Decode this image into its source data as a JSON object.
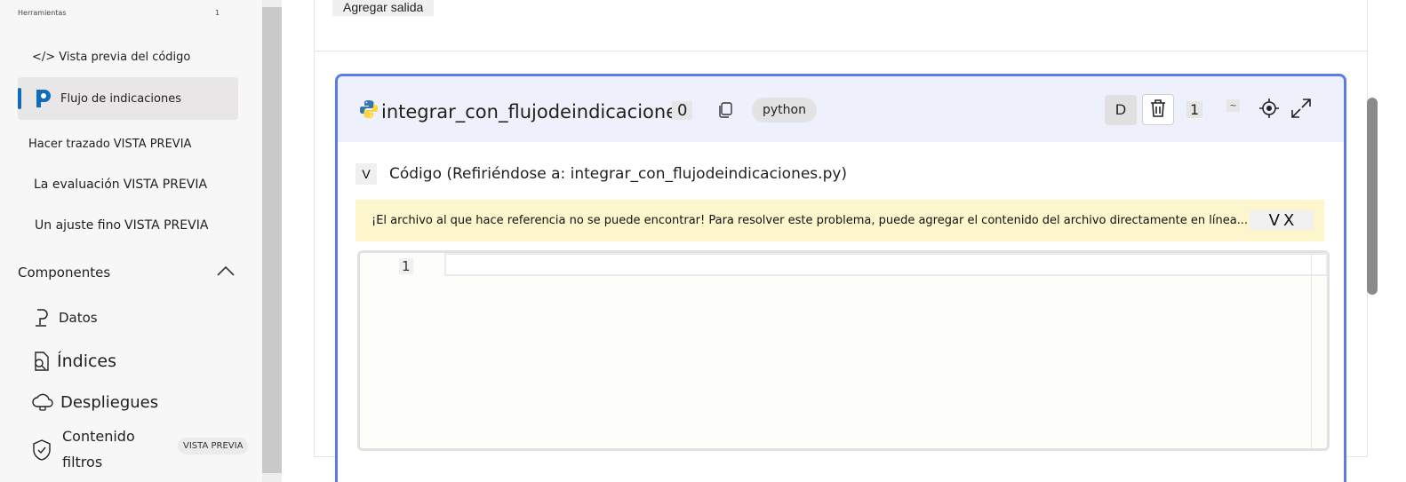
{
  "sidebar": {
    "top_label": "Herramientas",
    "top_count": "1",
    "items": [
      {
        "label": "</> Vista previa del código",
        "preview": ""
      },
      {
        "label": "Flujo de indicaciones",
        "preview": ""
      },
      {
        "label": "Hacer trazado",
        "preview": "VISTA PREVIA"
      },
      {
        "label": "La evaluación",
        "preview": "VISTA PREVIA"
      },
      {
        "label": "Un ajuste fino",
        "preview": "VISTA PREVIA"
      }
    ],
    "section_title": "Componentes",
    "components": [
      {
        "label": "Datos"
      },
      {
        "label": "Índices"
      },
      {
        "label": "Despliegues"
      },
      {
        "label_line1": "Contenido",
        "label_line2": "filtros",
        "badge": "VISTA PREVIA"
      }
    ]
  },
  "main": {
    "add_output_label": "Agregar salida",
    "cell": {
      "title": "integrar_con_flujodeindicaciones",
      "count": "0",
      "language": "python",
      "d_button": "D",
      "run_count": "1",
      "tilde": "~",
      "code_label": "Código (Refiriéndose a: integrar_con_flujodeindicaciones.py)",
      "chevron": "V",
      "warning": "¡El archivo al que hace referencia no se puede encontrar! Para resolver este problema, puede agregar el contenido del archivo directamente en línea...",
      "warning_expand": "V",
      "warning_close": "X",
      "line_number": "1"
    }
  },
  "colors": {
    "accent": "#0f6cbd",
    "cell_border": "#5b7bea",
    "cell_header_bg": "#eef1fc",
    "warning_bg": "#fdf5cc"
  },
  "icons": [
    "python-icon",
    "copy-icon",
    "trash-icon",
    "target-icon",
    "expand-icon",
    "prompt-flow-icon",
    "data-icon",
    "index-icon",
    "cloud-icon",
    "shield-icon",
    "chevron-up-icon"
  ]
}
